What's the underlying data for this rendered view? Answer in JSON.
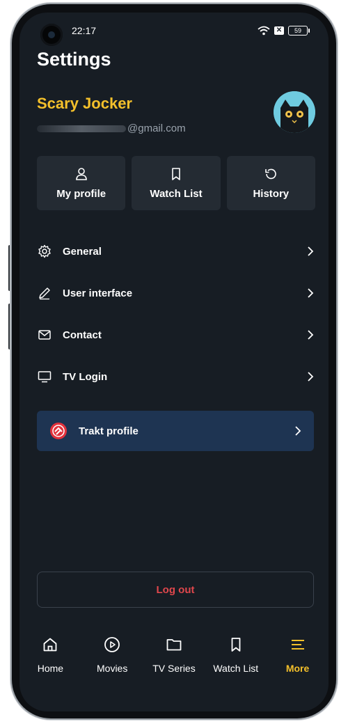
{
  "status_bar": {
    "time": "22:17",
    "battery": "59"
  },
  "page": {
    "title": "Settings"
  },
  "user": {
    "name": "Scary Jocker",
    "email_suffix": "@gmail.com"
  },
  "quick_actions": [
    {
      "label": "My profile",
      "icon": "person-icon"
    },
    {
      "label": "Watch List",
      "icon": "bookmark-icon"
    },
    {
      "label": "History",
      "icon": "history-icon"
    }
  ],
  "menu": [
    {
      "label": "General",
      "icon": "gear-icon"
    },
    {
      "label": "User interface",
      "icon": "pencil-icon"
    },
    {
      "label": "Contact",
      "icon": "mail-icon"
    },
    {
      "label": "TV Login",
      "icon": "monitor-icon"
    }
  ],
  "trakt": {
    "label": "Trakt profile",
    "icon": "trakt-logo-icon"
  },
  "logout": {
    "label": "Log out"
  },
  "bottom_nav": [
    {
      "label": "Home",
      "icon": "home-icon"
    },
    {
      "label": "Movies",
      "icon": "play-circle-icon"
    },
    {
      "label": "TV Series",
      "icon": "folder-icon"
    },
    {
      "label": "Watch List",
      "icon": "bookmark-icon"
    },
    {
      "label": "More",
      "icon": "menu-icon",
      "active": true
    }
  ],
  "colors": {
    "accent": "#f4c02b",
    "background": "#171d24",
    "card": "#242b33",
    "trakt_bg": "#1e3452",
    "logout": "#e0474c"
  }
}
